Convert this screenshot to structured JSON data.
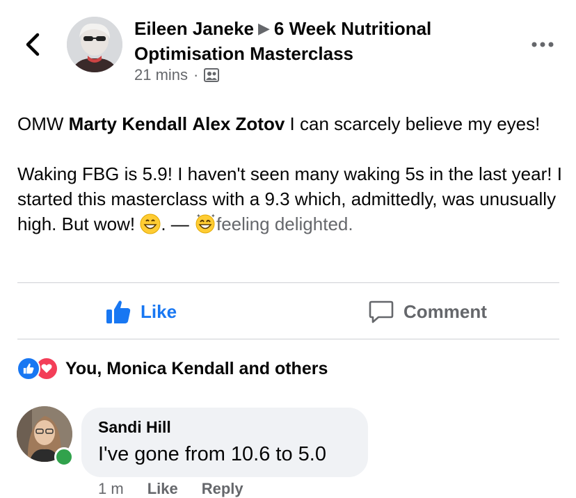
{
  "header": {
    "author": "Eileen Janeke",
    "group": "6 Week Nutritional Optimisation Masterclass",
    "time": "21 mins",
    "separator": "·",
    "audience_icon": "group-audience-icon"
  },
  "post": {
    "intro": "OMW ",
    "tag1": "Marty Kendall",
    "tag2": "Alex Zotov",
    "line1_rest": " I can scarcely believe my eyes!",
    "para2": "Waking FBG is 5.9! I haven't seen many waking 5s in the last year! I started this masterclass with a 9.3 which, admittedly, was unusually high. But wow! ",
    "after_emoji": ". — ",
    "feeling": "feeling delighted."
  },
  "actions": {
    "like": "Like",
    "comment": "Comment"
  },
  "reactions": {
    "summary": "You, Monica Kendall and others"
  },
  "comment": {
    "name": "Sandi Hill",
    "text": "I've gone from 10.6 to 5.0",
    "time": "1 m",
    "like": "Like",
    "reply": "Reply"
  },
  "colors": {
    "facebook_blue": "#1877f2",
    "secondary_text": "#65676b",
    "online_green": "#31a24c",
    "love_red": "#f33e58"
  }
}
